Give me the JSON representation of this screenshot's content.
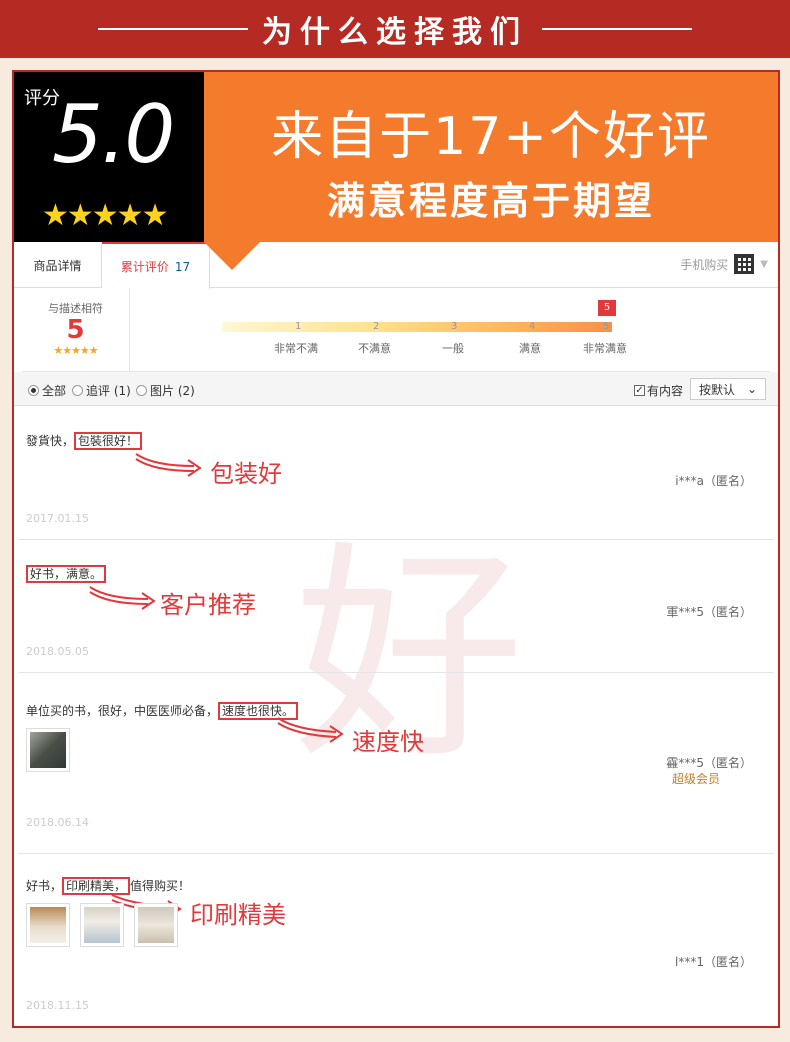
{
  "banner": {
    "title": "为什么选择我们"
  },
  "score": {
    "label": "评分",
    "value": "5.0",
    "stars": "★★★★★",
    "headline": "来自于17+个好评",
    "subheadline": "满意程度高于期望"
  },
  "tabs": {
    "details": "商品详情",
    "reviews": "累计评价",
    "review_count": "17",
    "mobile": "手机购买"
  },
  "rating": {
    "label": "与描述相符",
    "value": "5",
    "stars": "★★★★★",
    "marker": "5",
    "scale": [
      "1",
      "2",
      "3",
      "4",
      "5"
    ],
    "scale_labels": [
      "非常不满",
      "不满意",
      "一般",
      "满意",
      "非常满意"
    ]
  },
  "filter": {
    "all": "全部",
    "followup": "追评 (1)",
    "images": "图片 (2)",
    "has_content": "有内容",
    "sort": "按默认"
  },
  "watermark": "好",
  "reviews": [
    {
      "pre": "發貨快，",
      "highlight": "包裝很好！",
      "post": "",
      "user": "i***a（匿名）",
      "date": "2017.01.15",
      "annotation": "包装好"
    },
    {
      "pre": "",
      "highlight": "好书，满意。",
      "post": "",
      "user": "軍***5（匿名）",
      "date": "2018.05.05",
      "annotation": "客户推荐"
    },
    {
      "pre": "单位买的书，很好，中医医师必备，",
      "highlight": "速度也很快。",
      "post": "",
      "user": "靃***5（匿名）",
      "badge": "超级会员",
      "date": "2018.06.14",
      "annotation": "速度快"
    },
    {
      "pre": "好书，",
      "highlight": "印刷精美，",
      "post": "值得购买！",
      "user": "l***1（匿名）",
      "date": "2018.11.15",
      "annotation": "印刷精美"
    }
  ],
  "colors": {
    "brand_red": "#b52a22",
    "accent_orange": "#f47a2c",
    "highlight_red": "#e4393c"
  }
}
